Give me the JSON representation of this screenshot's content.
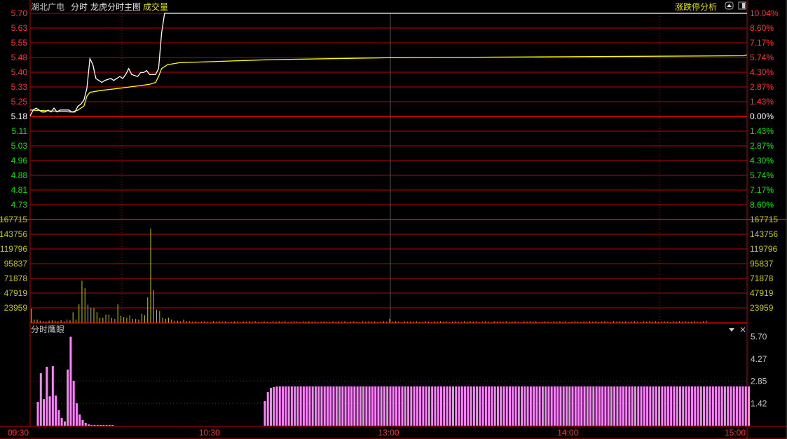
{
  "header": {
    "stock_name": "湖北广电",
    "mode": "分时",
    "main_chart": "龙虎分时主图",
    "volume_label": "成交量",
    "limit_analysis": "涨跌停分析"
  },
  "colors": {
    "grid": "#c00000",
    "price_line": "#ffffff",
    "avg_line": "#ffff00",
    "up": "#ff3232",
    "down": "#00e600",
    "volume": "#c8c800",
    "indicator": "#ff80ff"
  },
  "price_axis": {
    "left": [
      "5.70",
      "5.63",
      "5.55",
      "5.48",
      "5.40",
      "5.33",
      "5.25",
      "5.18",
      "5.11",
      "5.03",
      "4.96",
      "4.88",
      "4.81",
      "4.73"
    ],
    "right": [
      "10.04%",
      "8.60%",
      "7.17%",
      "5.74%",
      "4.30%",
      "2.87%",
      "1.43%",
      "0.00%",
      "1.43%",
      "2.87%",
      "4.30%",
      "5.74%",
      "7.17%",
      "8.60%"
    ],
    "prev_close": 5.18,
    "range": [
      4.73,
      5.7
    ]
  },
  "volume_axis": {
    "labels": [
      "167715",
      "143756",
      "119796",
      "95837",
      "71878",
      "47919",
      "23959"
    ],
    "max": 167715
  },
  "indicator": {
    "title": "分时鹰眼",
    "labels": [
      "5.70",
      "4.27",
      "2.85",
      "1.42"
    ],
    "max": 5.7,
    "early_start_minute": 2,
    "early_values": [
      1.52,
      3.36,
      1.7,
      3.77,
      1.88,
      3.81,
      1.93,
      0.99,
      0.49,
      0.27,
      3.59,
      5.7,
      2.87,
      1.43,
      0.72,
      0.36,
      0.18,
      0.08,
      0.05,
      0.05,
      0.05,
      0.05,
      0.05,
      0.05,
      0.05,
      0.05
    ],
    "late_start_minute": 78,
    "late_values": [
      1.57,
      2.15,
      2.42,
      2.47
    ],
    "late_plateau": 2.51
  },
  "time_axis": [
    {
      "label": "09:30",
      "minute": 0
    },
    {
      "label": "10:30",
      "minute": 60
    },
    {
      "label": "13:00",
      "minute": 120
    },
    {
      "label": "14:00",
      "minute": 180
    },
    {
      "label": "15:00",
      "minute": 240
    }
  ],
  "chart_data": {
    "type": "line",
    "price_points": [
      [
        0,
        5.18
      ],
      [
        1,
        5.21
      ],
      [
        2,
        5.22
      ],
      [
        3,
        5.21
      ],
      [
        4,
        5.2
      ],
      [
        5,
        5.2
      ],
      [
        6,
        5.21
      ],
      [
        7,
        5.2
      ],
      [
        8,
        5.22
      ],
      [
        9,
        5.2
      ],
      [
        10,
        5.21
      ],
      [
        13,
        5.21
      ],
      [
        14,
        5.2
      ],
      [
        15,
        5.2
      ],
      [
        16,
        5.23
      ],
      [
        17,
        5.24
      ],
      [
        18,
        5.26
      ],
      [
        19,
        5.32
      ],
      [
        20,
        5.47
      ],
      [
        21,
        5.44
      ],
      [
        22,
        5.37
      ],
      [
        23,
        5.36
      ],
      [
        24,
        5.35
      ],
      [
        25,
        5.36
      ],
      [
        27,
        5.37
      ],
      [
        28,
        5.36
      ],
      [
        29,
        5.37
      ],
      [
        30,
        5.38
      ],
      [
        31,
        5.37
      ],
      [
        32,
        5.39
      ],
      [
        33,
        5.42
      ],
      [
        34,
        5.39
      ],
      [
        36,
        5.38
      ],
      [
        37,
        5.4
      ],
      [
        38,
        5.4
      ],
      [
        39,
        5.41
      ],
      [
        40,
        5.39
      ],
      [
        42,
        5.39
      ],
      [
        43,
        5.42
      ],
      [
        44,
        5.6
      ],
      [
        45,
        5.7
      ],
      [
        240,
        5.7
      ]
    ],
    "avg_points": [
      [
        0,
        5.21
      ],
      [
        14,
        5.2
      ],
      [
        16,
        5.21
      ],
      [
        18,
        5.23
      ],
      [
        19,
        5.28
      ],
      [
        20,
        5.3
      ],
      [
        24,
        5.31
      ],
      [
        30,
        5.32
      ],
      [
        40,
        5.34
      ],
      [
        42,
        5.35
      ],
      [
        43,
        5.38
      ],
      [
        44,
        5.42
      ],
      [
        46,
        5.44
      ],
      [
        50,
        5.45
      ],
      [
        60,
        5.455
      ],
      [
        80,
        5.465
      ],
      [
        120,
        5.475
      ],
      [
        180,
        5.48
      ],
      [
        239,
        5.485
      ],
      [
        240,
        5.49
      ]
    ],
    "volume": [
      22800,
      5000,
      5000,
      3000,
      2000,
      2000,
      3000,
      4000,
      3000,
      2000,
      4000,
      2000,
      5000,
      4000,
      17000,
      5000,
      30000,
      68000,
      56000,
      29000,
      24000,
      24000,
      17000,
      8000,
      8000,
      13000,
      13000,
      8000,
      6000,
      30000,
      11000,
      9000,
      8000,
      12000,
      6000,
      6000,
      5000,
      14000,
      12000,
      41000,
      153000,
      53000,
      21000,
      19000,
      8000,
      6000,
      8000,
      5000,
      3000,
      3000,
      2000,
      5000,
      2000,
      2000,
      1500,
      2000,
      1000,
      1500,
      2000,
      1500,
      1000,
      2000,
      1500,
      2000,
      1500,
      2000,
      1000,
      1500,
      2000,
      1500,
      1000,
      2000,
      1500,
      2000,
      1500,
      2000,
      1000,
      1500,
      2000,
      1500,
      1000,
      2000,
      1500,
      2000,
      1500,
      2000,
      1000,
      1500,
      2000,
      1500,
      1000,
      2000,
      1500,
      2000,
      1500,
      2000,
      1000,
      1500,
      2000,
      1500,
      1000,
      2000,
      1500,
      2000,
      1500,
      2000,
      1000,
      1500,
      2000,
      1500,
      1000,
      2000,
      1500,
      2000,
      1500,
      2000,
      1000,
      1500,
      2000,
      1500,
      6000,
      1500,
      2000,
      1500,
      1000,
      2000,
      1500,
      2000,
      1500,
      2000,
      1000,
      1500,
      2000,
      1500,
      1000,
      2000,
      1500,
      2000,
      1500,
      2000,
      1000,
      1500,
      2000,
      1500,
      1000,
      2000,
      1500,
      2000,
      1500,
      2000,
      1000,
      1500,
      2000,
      1500,
      1000,
      2000,
      1500,
      2000,
      1500,
      2000,
      1000,
      1500,
      2000,
      1500,
      1000,
      2000,
      1500,
      2000,
      1500,
      2000,
      1000,
      1500,
      2000,
      1500,
      1000,
      2000,
      1500,
      2000,
      1500,
      2000,
      1000,
      1500,
      2000,
      1500,
      1000,
      2000,
      1500,
      2000,
      1500,
      2000,
      1000,
      1500,
      2000,
      1500,
      1000,
      2000,
      1500,
      2000,
      1500,
      2000,
      1000,
      1500,
      2000,
      1500,
      1000,
      2000,
      1500,
      2000,
      1500,
      2000,
      1000,
      1500,
      2000,
      1500,
      1000,
      2000,
      1500,
      2000,
      1500,
      2000,
      1000,
      1500,
      2000,
      1500,
      1000,
      2000,
      3000
    ]
  }
}
